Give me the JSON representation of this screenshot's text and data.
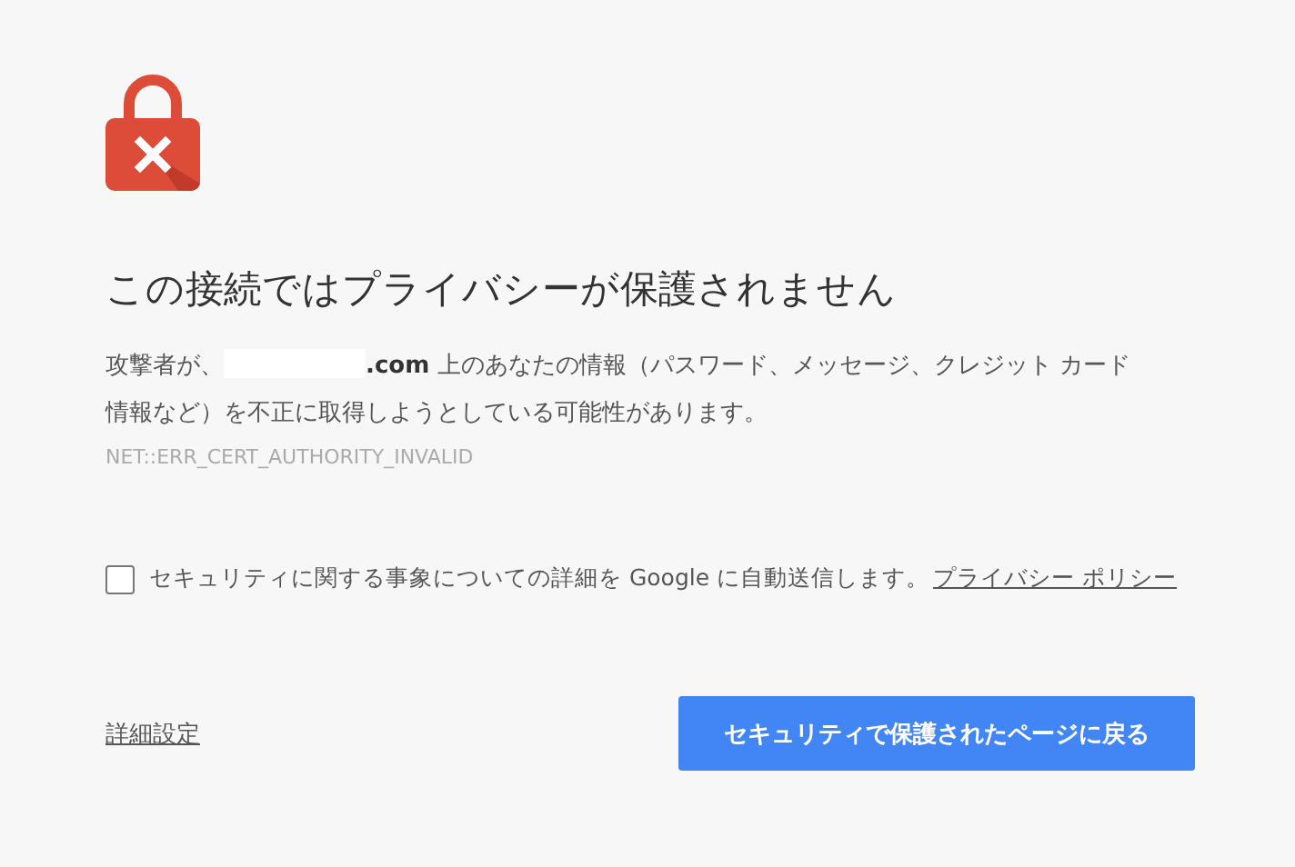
{
  "heading": "この接続ではプライバシーが保護されません",
  "message": {
    "before": "攻撃者が、",
    "after": "**.com** 上のあなたの情報（パスワード、メッセージ、クレジット カード情報など）を不正に取得しようとしている可能性があります。"
  },
  "error_code": "NET::ERR_CERT_AUTHORITY_INVALID",
  "report": {
    "checked": false,
    "label": "セキュリティに関する事象についての詳細を Google に自動送信します。",
    "link": "プライバシー ポリシー"
  },
  "advanced_link": "詳細設定",
  "back_button": "セキュリティで保護されたページに戻る"
}
